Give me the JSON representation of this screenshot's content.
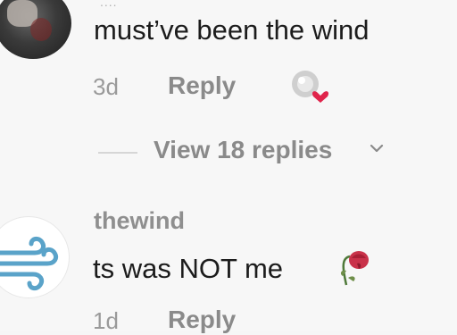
{
  "comments": [
    {
      "username_truncated": "....",
      "text": "must’ve been the wind",
      "time": "3d",
      "reply_label": "Reply",
      "liked_by_creator": true,
      "heart_color": "#e0244b"
    },
    {
      "username": "thewind",
      "text": "ts was NOT me",
      "emoji": "wilted-rose-icon",
      "time": "1d",
      "reply_label": "Reply",
      "wind_color": "#5aa3c9"
    }
  ],
  "replies_toggle": {
    "label": "View 18 replies"
  }
}
